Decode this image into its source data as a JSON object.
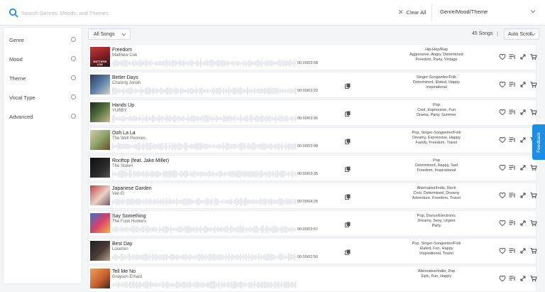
{
  "search": {
    "placeholder": "Search Genres, Moods, and Themes",
    "clear_label": "Clear All",
    "filter_label": "Genre/Mood/Theme"
  },
  "sidebar": {
    "items": [
      {
        "label": "Genre"
      },
      {
        "label": "Mood"
      },
      {
        "label": "Theme"
      },
      {
        "label": "Vocal Type"
      },
      {
        "label": "Advanced"
      }
    ]
  },
  "toolbar": {
    "all_songs_label": "All Songs",
    "count_label": "45 Songs",
    "separator": "|",
    "auto_scroll_label": "Auto Scroll"
  },
  "songs": [
    {
      "title": "Freedom",
      "artist": "Matthew Coe",
      "duration": "00:00/03:58",
      "stems": false,
      "cover_text": "MATTHEW COE",
      "tags": [
        "Hip-Hop/Rap",
        "Aggressive, Angry, Determined",
        "Freedom, Party, Vintage"
      ]
    },
    {
      "title": "Better Days",
      "artist": "Chasing Jonah",
      "duration": "00:00/03:22",
      "stems": true,
      "tags": [
        "Singer-Songwriter/Folk",
        "Determined, Elated, Happy",
        "Inspirational"
      ]
    },
    {
      "title": "Hands Up",
      "artist": "YURBY",
      "duration": "00:00/03:36",
      "stems": true,
      "tags": [
        "Pop",
        "Cool, Expressive, Fun",
        "Drama, Party, Summer"
      ]
    },
    {
      "title": "Ooh La La",
      "artist": "The Well Pennies",
      "duration": "00:00/03:08",
      "stems": true,
      "tags": [
        "Pop, Singer-Songwriter/Folk",
        "Dreamy, Expressive, Happy",
        "Family, Freedom, Travel"
      ]
    },
    {
      "title": "Rooftop (feat. Jake Miller)",
      "artist": "The Stolen",
      "duration": "00:00/03:35",
      "stems": true,
      "tags": [
        "Pop",
        "Determined, Happy, Sad",
        "Freedom, Inspirational"
      ]
    },
    {
      "title": "Japanese Garden",
      "artist": "Van Ei",
      "duration": "00:00/04:25",
      "stems": true,
      "tags": [
        "Alternative/Indie, Rock",
        "Cool, Determined, Dreamy",
        "Adventure, Freedom, Travel"
      ]
    },
    {
      "title": "Say Something",
      "artist": "The Funk Hunters",
      "duration": "00:00/03:57",
      "stems": true,
      "tags": [
        "Pop, Dance/Electronic",
        "Dreamy, Sexy, Urgent",
        "Party"
      ]
    },
    {
      "title": "Best Day",
      "artist": "Losemin",
      "duration": "00:00/02:50",
      "stems": true,
      "tags": [
        "Pop, Singer-Songwriter/Folk",
        "Elated, Fun, Happy",
        "Inspirational, Travel"
      ]
    },
    {
      "title": "Tell Me No",
      "artist": "Grayson Erhard",
      "duration": "",
      "stems": false,
      "tags": [
        "Alternative/Indie, Pop",
        "Epic, Fun, Happy",
        ""
      ]
    }
  ],
  "feedback_label": "Feedback",
  "colors": {
    "accent": "#1a8fe3",
    "background": "#f4f5f7",
    "panel": "#ffffff"
  },
  "icons": [
    "search-icon",
    "close-icon",
    "chevron-down-icon",
    "stems-icon",
    "heart-icon",
    "playlist-add-icon",
    "expand-icon",
    "cart-icon"
  ]
}
